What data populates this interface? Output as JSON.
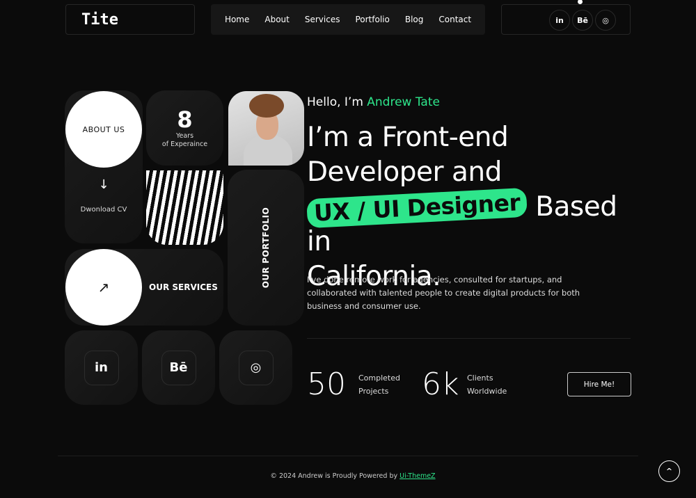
{
  "header": {
    "logo": "Tite",
    "nav": [
      "Home",
      "About",
      "Services",
      "Portfolio",
      "Blog",
      "Contact"
    ],
    "social": [
      {
        "icon": "linkedin-icon",
        "label": "in"
      },
      {
        "icon": "behance-icon",
        "label": "Bē"
      },
      {
        "icon": "dribbble-icon",
        "label": "◎"
      }
    ]
  },
  "grid": {
    "about": "ABOUT US",
    "years_num": "8",
    "years_l1": "Years",
    "years_l2": "of Experaince",
    "download": "Dwonload CV",
    "services": "OUR SERVICES",
    "portfolio": "OUR PORTFOLIO",
    "social": [
      {
        "icon": "linkedin-icon",
        "label": "in"
      },
      {
        "icon": "behance-icon",
        "label": "Bē"
      },
      {
        "icon": "dribbble-icon",
        "label": "◎"
      }
    ]
  },
  "hero": {
    "hello": "Hello, I’m ",
    "name": "Andrew Tate",
    "line1": "I’m a Front-end",
    "line2": "Developer and",
    "highlight": "UX / UI Designer",
    "line3_rest": " Based in",
    "line4": "California.",
    "desc": "I've done remote work for agencies, consulted for startups, and collaborated with talented people to create digital products for both business and consumer use."
  },
  "stats": [
    {
      "value": "50",
      "l1": "Completed",
      "l2": "Projects"
    },
    {
      "value": "6k",
      "l1": "Clients",
      "l2": "Worldwide"
    }
  ],
  "hire": "Hire Me!",
  "footer": {
    "text": "© 2024 Andrew is Proudly Powered by ",
    "link": "Ui-ThemeZ"
  },
  "colors": {
    "accent": "#2ee58b",
    "bg": "#0b0b0b"
  }
}
